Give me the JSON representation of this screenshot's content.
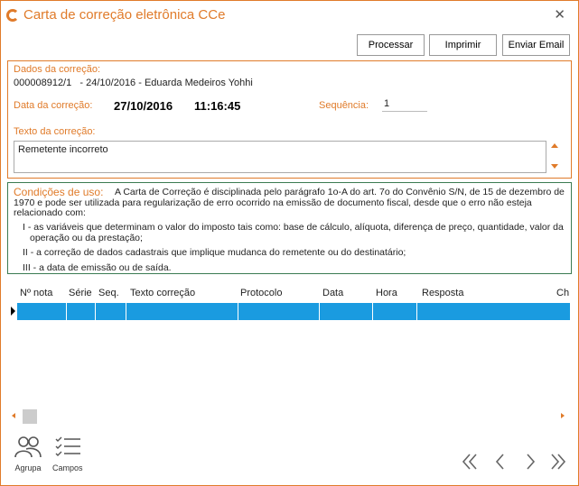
{
  "window": {
    "title": "Carta de correção eletrônica CCe",
    "close_label": "✕"
  },
  "toolbar": {
    "processar": "Processar",
    "imprimir": "Imprimir",
    "enviar_email": "Enviar Email"
  },
  "dados": {
    "label": "Dados da correção:",
    "value": "000008912/1   - 24/10/2016 - Eduarda Medeiros Yohhi",
    "data_label": "Data da correção:",
    "data_value": "27/10/2016",
    "hora_value": "11:16:45",
    "sequencia_label": "Sequência:",
    "sequencia_value": "1",
    "texto_label": "Texto da correção:",
    "texto_value": "Remetente incorreto"
  },
  "condicoes": {
    "title": "Condições de uso:",
    "line1": "A Carta de Correção é disciplinada pelo parágrafo 1o-A do art. 7o do Convênio S/N, de 15 de dezembro de",
    "line2": "1970 e pode ser utilizada para regularização de erro ocorrido na emissão de documento fiscal, desde que o erro não esteja",
    "line3": "relacionado com:",
    "item1a": "I - as variáveis que determinam o valor do imposto tais como: base de cálculo, alíquota, diferença de preço, quantidade, valor da",
    "item1b": "operação ou da prestação;",
    "item2": "II - a correção de dados cadastrais que implique mudanca do remetente ou do destinatário;",
    "item3": "III - a data de emissão ou de saída."
  },
  "grid": {
    "columns": [
      "Nº nota",
      "Série",
      "Seq.",
      "Texto correção",
      "Protocolo",
      "Data",
      "Hora",
      "Resposta",
      "Ch"
    ]
  },
  "bottom": {
    "agrupa": "Agrupa",
    "campos": "Campos"
  },
  "colors": {
    "accent": "#e07b2a",
    "selection": "#1a9be0",
    "cond_border": "#3b7b52"
  }
}
